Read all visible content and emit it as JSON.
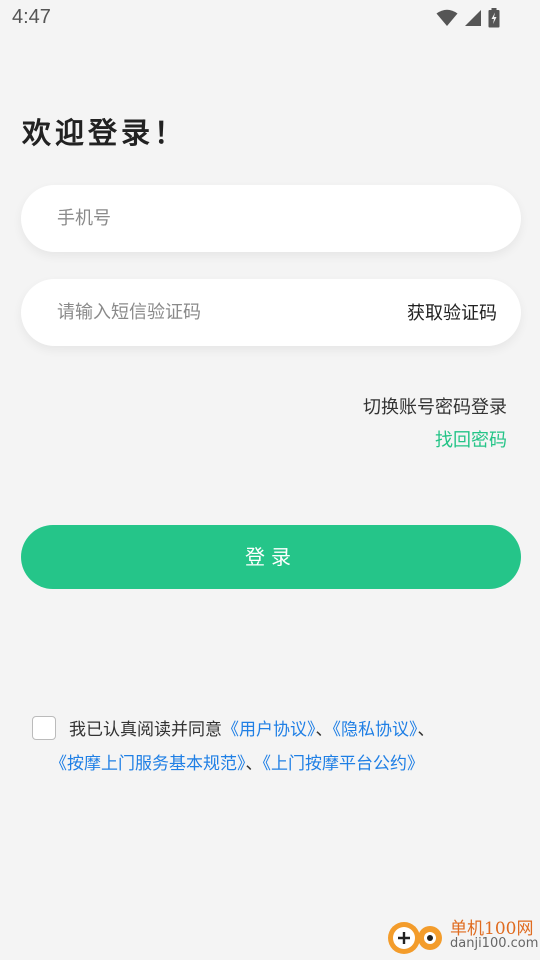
{
  "status_bar": {
    "time": "4:47",
    "icons": [
      "wifi-icon",
      "cellular-signal-icon",
      "battery-charging-icon"
    ]
  },
  "login": {
    "title": "欢迎登录！",
    "phone_placeholder": "手机号",
    "code_placeholder": "请输入短信验证码",
    "get_code_label": "获取验证码",
    "switch_to_password_label": "切换账号密码登录",
    "forgot_password_label": "找回密码",
    "submit_label": "登录"
  },
  "agreement": {
    "checked": false,
    "prefix": "我已认真阅读并同意",
    "links": [
      "《用户协议》",
      "《隐私协议》",
      "《按摩上门服务基本规范》",
      "《上门按摩平台公约》"
    ],
    "separator": "、"
  },
  "watermark": {
    "name": "单机100网",
    "url": "danji100.com"
  },
  "colors": {
    "accent": "#25c589",
    "link": "#1f7fe5",
    "background": "#f4f4f4"
  }
}
